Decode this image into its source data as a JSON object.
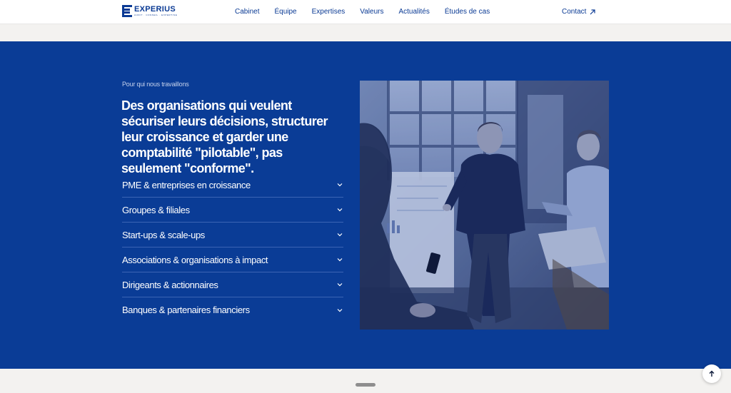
{
  "header": {
    "logo": {
      "name": "EXPERIUS",
      "tagline": "AUDIT · CONSEIL · EXPERTISE"
    },
    "nav": [
      "Cabinet",
      "Équipe",
      "Expertises",
      "Valeurs",
      "Actualités",
      "Études de cas"
    ],
    "contact_label": "Contact"
  },
  "section": {
    "eyebrow": "Pour qui nous travaillons",
    "headline": "Des organisations qui veulent sécuriser leurs décisions, structurer leur croissance et garder une comptabilité \"pilotable\", pas seulement \"conforme\".",
    "items": [
      "PME & entreprises en croissance",
      "Groupes & filiales",
      "Start-ups & scale-ups",
      "Associations & organisations à impact",
      "Dirigeants & actionnaires",
      "Banques & partenaires financiers"
    ]
  },
  "colors": {
    "brand_blue": "#0a3c96",
    "nav_text": "#0a3a94",
    "background": "#f3f2f0"
  },
  "icons": {
    "contact": "arrow-up-right-icon",
    "accordion": "chevron-down-icon",
    "back_to_top": "arrow-up-icon"
  }
}
